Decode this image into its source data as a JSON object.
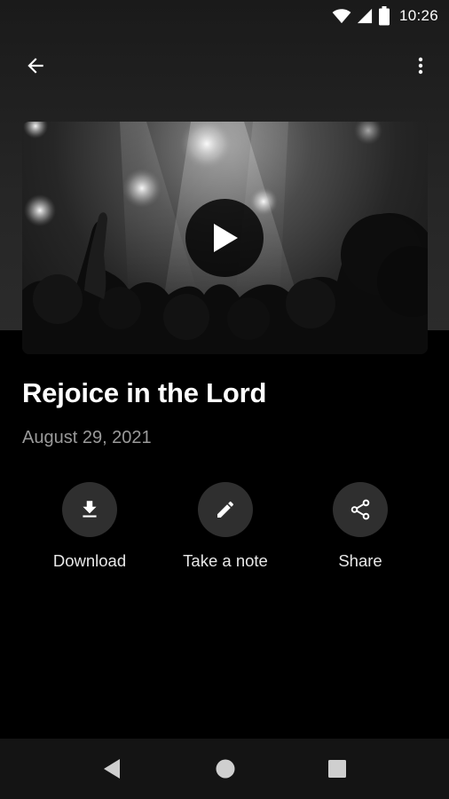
{
  "status_bar": {
    "time": "10:26",
    "icons": [
      "wifi-icon",
      "cellular-signal-icon",
      "battery-icon"
    ]
  },
  "app_bar": {
    "back_icon": "arrow-left-icon",
    "menu_icon": "more-vertical-icon"
  },
  "video": {
    "thumbnail": "concert-crowd-stage-lights",
    "play_icon": "play-icon"
  },
  "sermon": {
    "title": "Rejoice in the Lord",
    "date": "August 29, 2021"
  },
  "actions": [
    {
      "label": "Download",
      "icon": "download-icon"
    },
    {
      "label": "Take a note",
      "icon": "pencil-icon"
    },
    {
      "label": "Share",
      "icon": "share-icon"
    }
  ],
  "nav_bar": {
    "buttons": [
      "nav-back-triangle-icon",
      "nav-home-circle-icon",
      "nav-recents-square-icon"
    ]
  },
  "colors": {
    "background": "#000000",
    "header_band": "#262626",
    "action_circle": "#2f2f2f",
    "date_text": "#9a9a9a",
    "nav_bar": "#141414"
  }
}
